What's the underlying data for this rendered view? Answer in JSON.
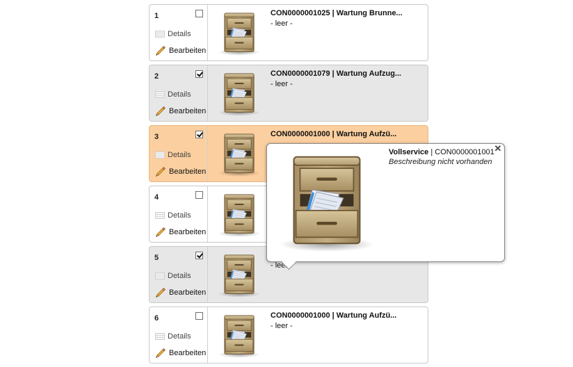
{
  "rows": [
    {
      "num": "1",
      "checked": false,
      "state": "normal",
      "details_label": "Details",
      "edit_label": "Bearbeiten",
      "title": "CON0000001025 | Wartung Brunne...",
      "subtitle": "- leer -"
    },
    {
      "num": "2",
      "checked": true,
      "state": "checked",
      "details_label": "Details",
      "edit_label": "Bearbeiten",
      "title": "CON0000001079 | Wartung Aufzug...",
      "subtitle": "- leer -"
    },
    {
      "num": "3",
      "checked": true,
      "state": "highlight",
      "details_label": "Details",
      "edit_label": "Bearbeiten",
      "title": "CON0000001000 | Wartung Aufzü...",
      "subtitle": "-"
    },
    {
      "num": "4",
      "checked": false,
      "state": "normal",
      "details_label": "Details",
      "edit_label": "Bearbeiten",
      "title": "",
      "subtitle": ""
    },
    {
      "num": "5",
      "checked": true,
      "state": "checked",
      "details_label": "Details",
      "edit_label": "Bearbeiten",
      "title": "",
      "subtitle": "- leer"
    },
    {
      "num": "6",
      "checked": false,
      "state": "normal",
      "details_label": "Details",
      "edit_label": "Bearbeiten",
      "title": "CON0000001000 | Wartung Aufzü...",
      "subtitle": "- leer -"
    }
  ],
  "popup": {
    "name": "Vollservice",
    "separator": " | ",
    "code": "CON0000001001",
    "description": "Beschreibung nicht vorhanden",
    "close_glyph": "✕"
  },
  "colors": {
    "row_checked_bg": "#e7e7e7",
    "row_highlight_bg": "#fbcf9f"
  },
  "icons": {
    "thumb": "file-cabinet-icon",
    "details": "details-icon",
    "edit": "pencil-icon",
    "close": "close-icon"
  }
}
